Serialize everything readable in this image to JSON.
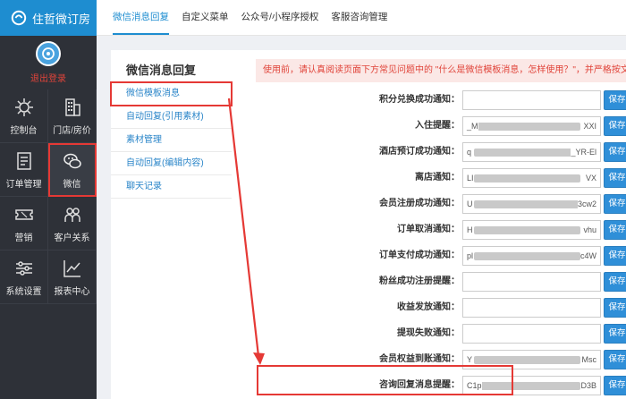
{
  "app": {
    "title": "住哲微订房"
  },
  "user": {
    "logout_label": "退出登录"
  },
  "nav": [
    {
      "label": "控制台",
      "icon": "gear-icon"
    },
    {
      "label": "门店/房价",
      "icon": "building-icon"
    },
    {
      "label": "订单管理",
      "icon": "document-icon"
    },
    {
      "label": "微信",
      "icon": "wechat-icon",
      "active": true
    },
    {
      "label": "营销",
      "icon": "ticket-icon"
    },
    {
      "label": "客户关系",
      "icon": "users-icon"
    },
    {
      "label": "系统设置",
      "icon": "sliders-icon"
    },
    {
      "label": "报表中心",
      "icon": "chart-icon"
    }
  ],
  "tabs": [
    {
      "label": "微信消息回复",
      "active": true
    },
    {
      "label": "自定义菜单"
    },
    {
      "label": "公众号/小程序授权"
    },
    {
      "label": "客服咨询管理"
    }
  ],
  "sub_menu": {
    "title": "微信消息回复",
    "items": [
      {
        "label": "微信模板消息",
        "active": true
      },
      {
        "label": "自动回复(引用素材)"
      },
      {
        "label": "素材管理"
      },
      {
        "label": "自动回复(编辑内容)"
      },
      {
        "label": "聊天记录"
      }
    ]
  },
  "notice": "使用前，请认真阅读页面下方常见问题中的 \"什么是微信模板消息，怎样使用？\"，并严格按文中方",
  "save_label": "保存",
  "form": [
    {
      "label": "积分兑换成功通知：",
      "start": "",
      "end": ""
    },
    {
      "label": "入住提醒：",
      "start": "_M",
      "end": "XXI"
    },
    {
      "label": "酒店预订成功通知：",
      "start": "q",
      "end": "_YR-El"
    },
    {
      "label": "离店通知：",
      "start": "LI",
      "end": "VX"
    },
    {
      "label": "会员注册成功通知：",
      "start": "U",
      "end": "3cw2"
    },
    {
      "label": "订单取消通知：",
      "start": "H",
      "end": "vhu"
    },
    {
      "label": "订单支付成功通知：",
      "start": "pl",
      "end": "c4W"
    },
    {
      "label": "粉丝成功注册提醒：",
      "start": "",
      "end": ""
    },
    {
      "label": "收益发放通知：",
      "start": "",
      "end": ""
    },
    {
      "label": "提现失败通知：",
      "start": "",
      "end": ""
    },
    {
      "label": "会员权益到账通知：",
      "start": "Y",
      "end": "Msc"
    },
    {
      "label": "咨询回复消息提醒：",
      "start": "C1p",
      "end": "D3B"
    }
  ],
  "colors": {
    "accent": "#1e8dd0",
    "sidebar": "#2e3138",
    "highlight": "#e53935",
    "save": "#2f8fd8"
  }
}
